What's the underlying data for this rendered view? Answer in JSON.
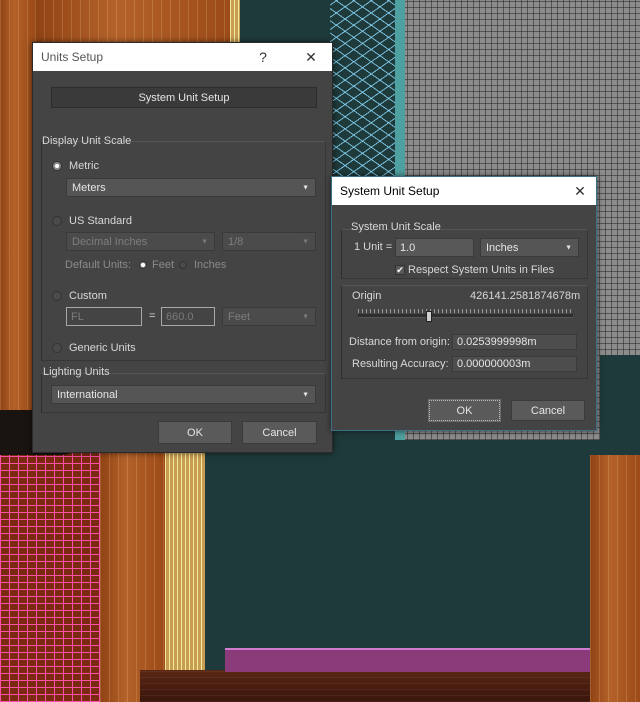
{
  "units_setup": {
    "title": "Units Setup",
    "help_glyph": "?",
    "close_glyph": "✕",
    "system_unit_setup_button": "System Unit Setup",
    "display_unit_scale_label": "Display Unit Scale",
    "metric_label": "Metric",
    "metric_value": "Meters",
    "us_standard_label": "US Standard",
    "us_standard_value": "Decimal Inches",
    "fraction_value": "1/8",
    "default_units_label": "Default Units:",
    "feet_label": "Feet",
    "inches_label": "Inches",
    "custom_label": "Custom",
    "custom_name_value": "FL",
    "equals_sign": "=",
    "custom_amount_value": "660.0",
    "custom_unit_value": "Feet",
    "generic_units_label": "Generic Units",
    "lighting_units_label": "Lighting Units",
    "lighting_units_value": "International",
    "ok_label": "OK",
    "cancel_label": "Cancel",
    "selected_scale": "Metric",
    "selected_default_unit": "Feet"
  },
  "system_unit_setup": {
    "title": "System Unit Setup",
    "close_glyph": "✕",
    "system_unit_scale_label": "System Unit Scale",
    "one_unit_label": "1 Unit =",
    "unit_amount_value": "1.0",
    "unit_type_value": "Inches",
    "respect_units_label": "Respect System Units in Files",
    "respect_units_checked": true,
    "checkmark_glyph": "✔",
    "origin_label": "Origin",
    "origin_value": "426141.2581874678m",
    "distance_label": "Distance from origin:",
    "distance_value": "0.0253999998m",
    "accuracy_label": "Resulting Accuracy:",
    "accuracy_value": "0.000000003m",
    "ok_label": "OK",
    "cancel_label": "Cancel"
  },
  "icons": {
    "dropdown_arrow": "▼"
  }
}
